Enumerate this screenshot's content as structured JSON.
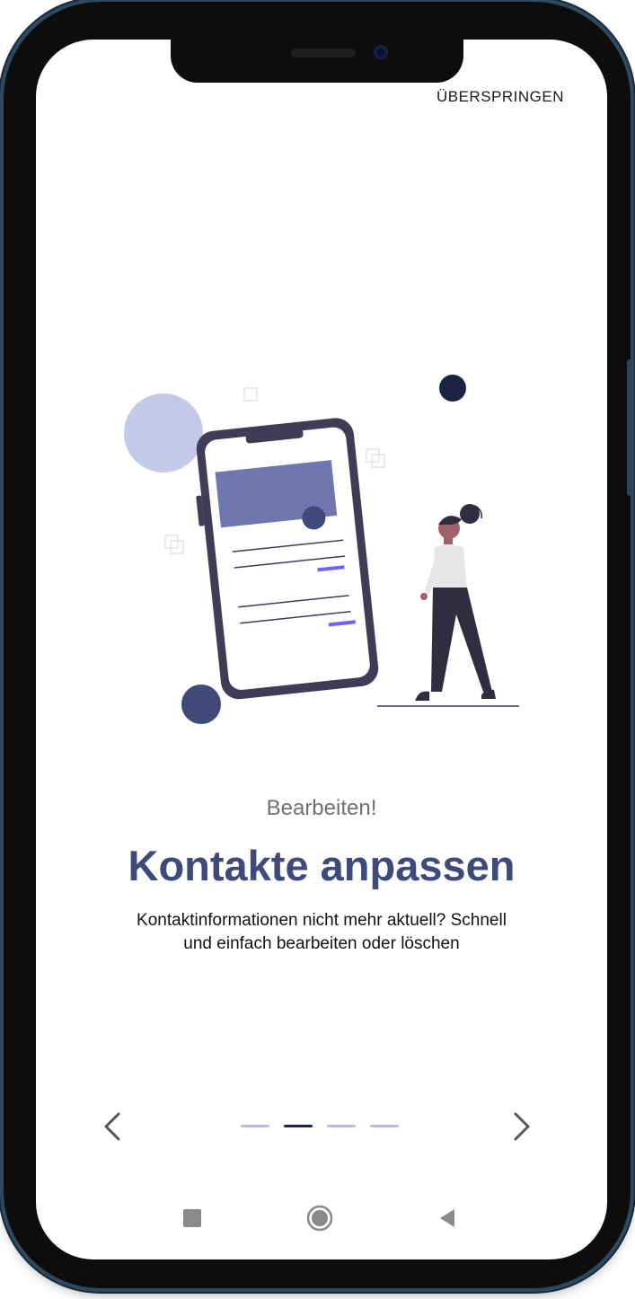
{
  "header": {
    "skip_label": "ÜBERSPRINGEN"
  },
  "onboarding": {
    "subtitle": "Bearbeiten!",
    "title": "Kontakte anpassen",
    "description": "Kontaktinformationen nicht mehr aktuell? Schnell und einfach bearbeiten oder löschen",
    "total_pages": 4,
    "active_page": 2
  },
  "icons": {
    "prev": "chevron-left-icon",
    "next": "chevron-right-icon",
    "recents": "square-icon",
    "home": "circle-icon",
    "back": "triangle-back-icon"
  },
  "colors": {
    "title": "#3d4a7a",
    "accent": "#6c63ff",
    "dot_active": "#1d2342",
    "dot_inactive": "#b7bde0",
    "illustration_dark": "#3f3d56",
    "illustration_blue": "#6e77b0"
  }
}
